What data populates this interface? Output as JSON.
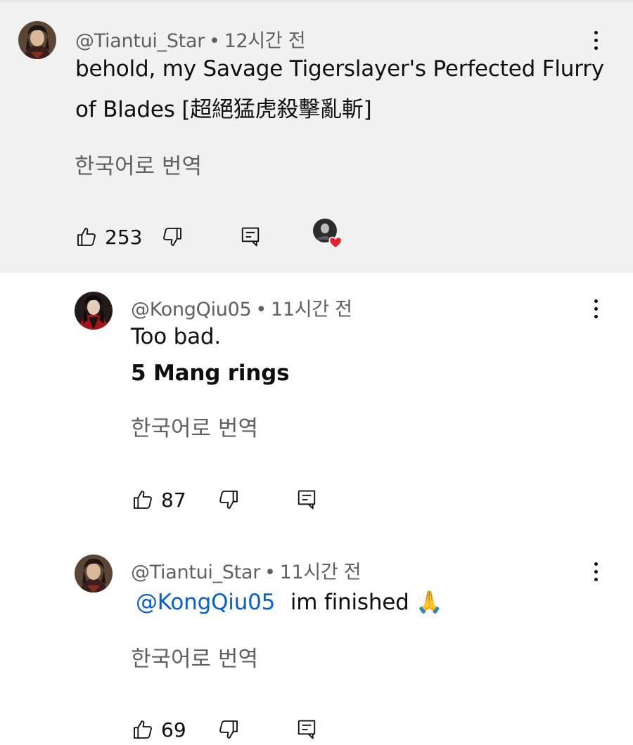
{
  "comments": [
    {
      "author": "@Tiantui_Star",
      "separator": "•",
      "time": "12시간 전",
      "text_line1": "behold, my Savage Tigerslayer's Perfected Flurry",
      "text_line2": "of Blades [超絕猛虎殺擊亂斬]",
      "translate_label": "한국어로 번역",
      "likes": "253",
      "creator_hearted": true
    },
    {
      "author": "@KongQiu05",
      "separator": "•",
      "time": "11시간 전",
      "text_line1": "Too bad.",
      "text_line2": "5 Mang rings",
      "translate_label": "한국어로 번역",
      "likes": "87"
    },
    {
      "author": "@Tiantui_Star",
      "separator": "•",
      "time": "11시간 전",
      "mention": "@KongQiu05",
      "text": "im finished",
      "emoji": "🙏",
      "translate_label": "한국어로 번역",
      "likes": "69"
    }
  ],
  "colors": {
    "highlight_bg": "#f1f1f1",
    "meta": "#606060",
    "mention": "#065fd4",
    "heart": "#e8212e"
  },
  "icons": [
    "thumb-up-icon",
    "thumb-down-icon",
    "reply-icon",
    "more-vert-icon",
    "heart-icon"
  ]
}
